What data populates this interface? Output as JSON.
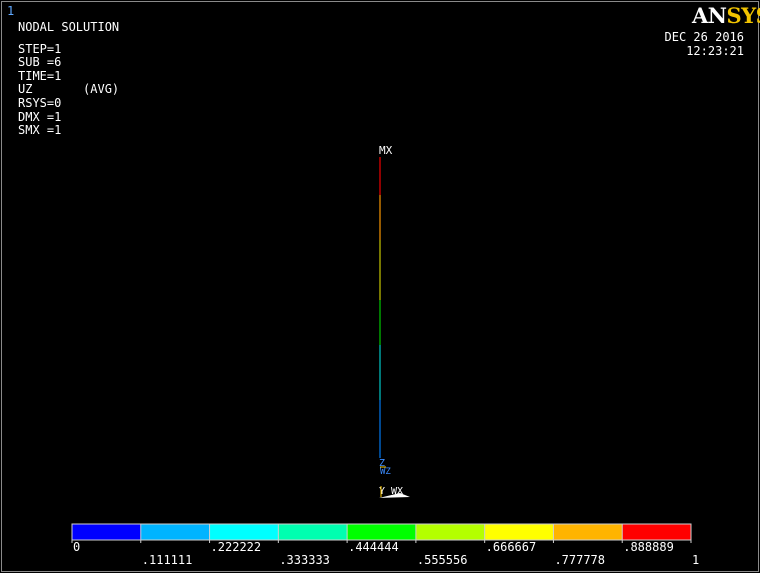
{
  "window_number": "1",
  "logo": {
    "part1": "AN",
    "part2": "SYS"
  },
  "info_lines_top": [
    "NODAL SOLUTION"
  ],
  "info_lines": [
    "STEP=1",
    "SUB =6",
    "TIME=1",
    "UZ       (AVG)",
    "RSYS=0",
    "DMX =1",
    "SMX =1"
  ],
  "date": "DEC 26 2016",
  "time": "12:23:21",
  "labels": {
    "mx": "MX",
    "triad_z": "Z",
    "triad_wz": "WZ",
    "triad_bottom": "Y WX"
  },
  "legend": {
    "colors": [
      "#0000ff",
      "#00b4ff",
      "#00ffff",
      "#00ffb0",
      "#00ff00",
      "#b4ff00",
      "#ffff00",
      "#ffb400",
      "#ff0000"
    ],
    "top_labels": [
      "0",
      ".222222",
      ".444444",
      ".666667",
      ".888889"
    ],
    "bottom_labels": [
      ".111111",
      ".333333",
      ".555556",
      ".777778",
      "1"
    ]
  }
}
